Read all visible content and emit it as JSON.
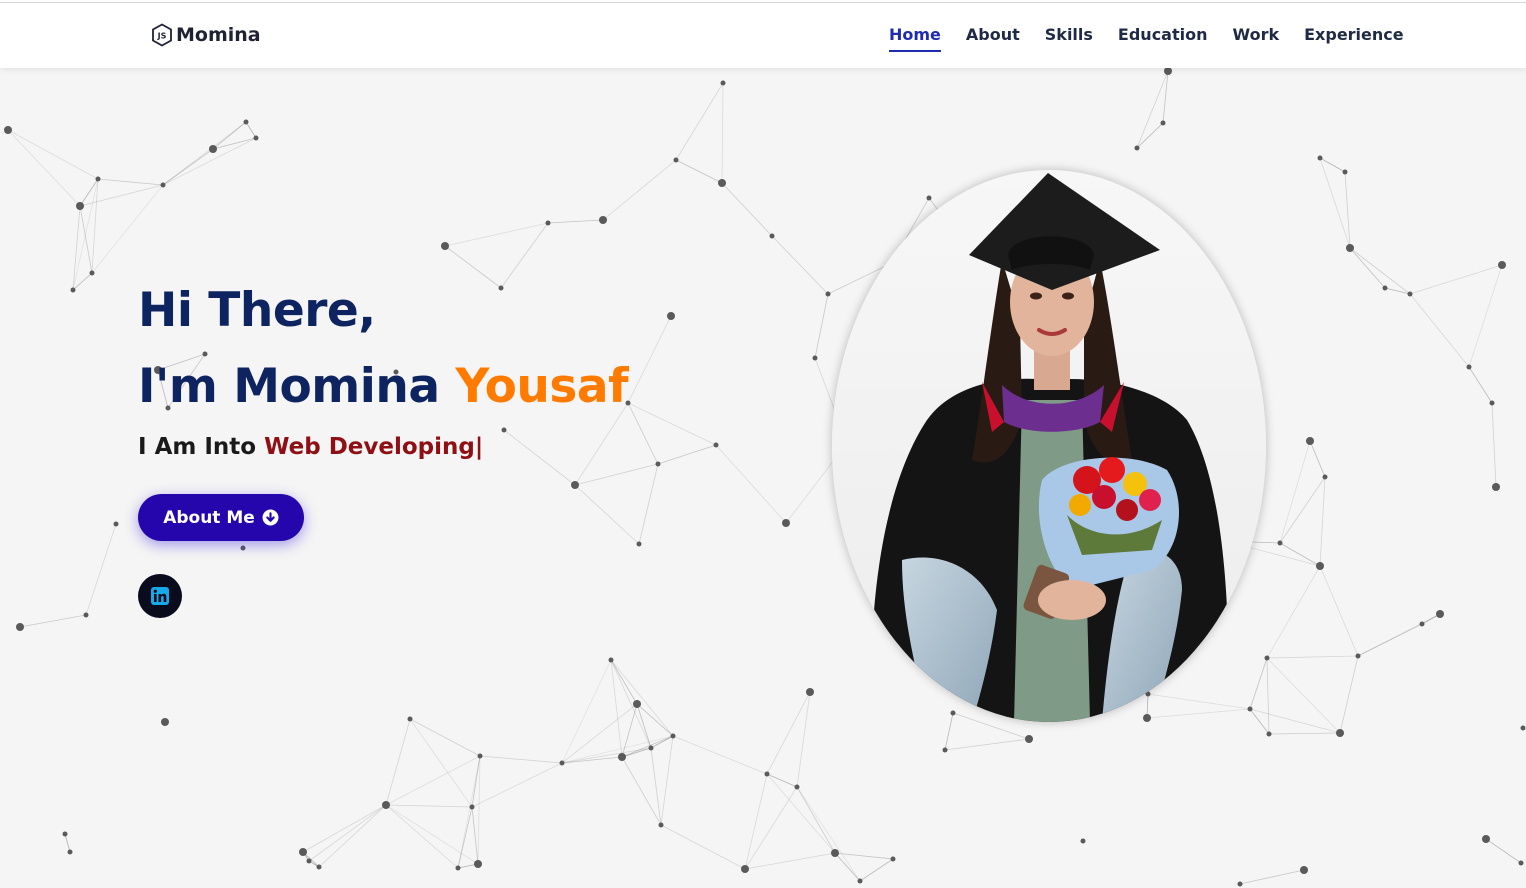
{
  "brand": {
    "name": "Momina",
    "logo_icon": "js-hexagon-icon"
  },
  "nav": {
    "items": [
      {
        "label": "Home",
        "active": true
      },
      {
        "label": "About",
        "active": false
      },
      {
        "label": "Skills",
        "active": false
      },
      {
        "label": "Education",
        "active": false
      },
      {
        "label": "Work",
        "active": false
      },
      {
        "label": "Experience",
        "active": false
      }
    ],
    "active_color": "#1f2bb0"
  },
  "hero": {
    "greeting": "Hi There,",
    "intro_prefix": "I'm Momina ",
    "intro_highlight": "Yousaf",
    "tagline_prefix": "I Am Into ",
    "tagline_typed": "Web Developing",
    "cursor": "|",
    "cta_label": "About Me",
    "cta_icon": "arrow-down-circle-icon",
    "social_icon": "linkedin-icon"
  },
  "colors": {
    "heading": "#0e2460",
    "accent": "#ff7b00",
    "typed": "#8e0f14",
    "button": "#2506ad"
  }
}
